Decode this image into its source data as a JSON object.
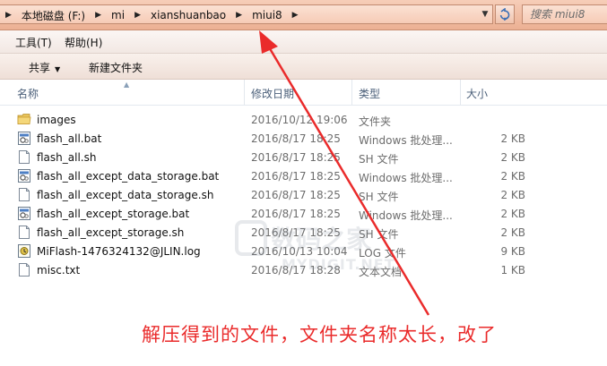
{
  "address_bar": {
    "crumbs": [
      "本地磁盘 (F:)",
      "mi",
      "xianshuanbao",
      "miui8"
    ],
    "search_placeholder": "搜索 miui8"
  },
  "menu": {
    "items": [
      "工具(T)",
      "帮助(H)"
    ]
  },
  "toolbar": {
    "share_label": "共享",
    "new_folder_label": "新建文件夹"
  },
  "columns": {
    "name": "名称",
    "date": "修改日期",
    "type": "类型",
    "size": "大小"
  },
  "files": [
    {
      "icon": "folder-icon",
      "name": "images",
      "date": "2016/10/12 19:06",
      "type": "文件夹",
      "size": ""
    },
    {
      "icon": "bat-file-icon",
      "name": "flash_all.bat",
      "date": "2016/8/17 18:25",
      "type": "Windows 批处理...",
      "size": "2 KB"
    },
    {
      "icon": "text-file-icon",
      "name": "flash_all.sh",
      "date": "2016/8/17 18:25",
      "type": "SH 文件",
      "size": "2 KB"
    },
    {
      "icon": "bat-file-icon",
      "name": "flash_all_except_data_storage.bat",
      "date": "2016/8/17 18:25",
      "type": "Windows 批处理...",
      "size": "2 KB"
    },
    {
      "icon": "text-file-icon",
      "name": "flash_all_except_data_storage.sh",
      "date": "2016/8/17 18:25",
      "type": "SH 文件",
      "size": "2 KB"
    },
    {
      "icon": "bat-file-icon",
      "name": "flash_all_except_storage.bat",
      "date": "2016/8/17 18:25",
      "type": "Windows 批处理...",
      "size": "2 KB"
    },
    {
      "icon": "text-file-icon",
      "name": "flash_all_except_storage.sh",
      "date": "2016/8/17 18:25",
      "type": "SH 文件",
      "size": "2 KB"
    },
    {
      "icon": "log-file-icon",
      "name": "MiFlash-1476324132@JLIN.log",
      "date": "2016/10/13 10:04",
      "type": "LOG 文件",
      "size": "9 KB"
    },
    {
      "icon": "text-file-icon",
      "name": "misc.txt",
      "date": "2016/8/17 18:28",
      "type": "文本文档",
      "size": "1 KB"
    }
  ],
  "annotation": {
    "text": "解压得到的文件，文件夹名称太长，改了",
    "color": "#ea2b2b"
  },
  "watermark": {
    "text": "数码之家",
    "sub": "MYDIGIT.NET"
  },
  "colors": {
    "title_bar": "#ecb093",
    "header_text": "#4c607a",
    "secondary_text": "#6d6d6d"
  }
}
